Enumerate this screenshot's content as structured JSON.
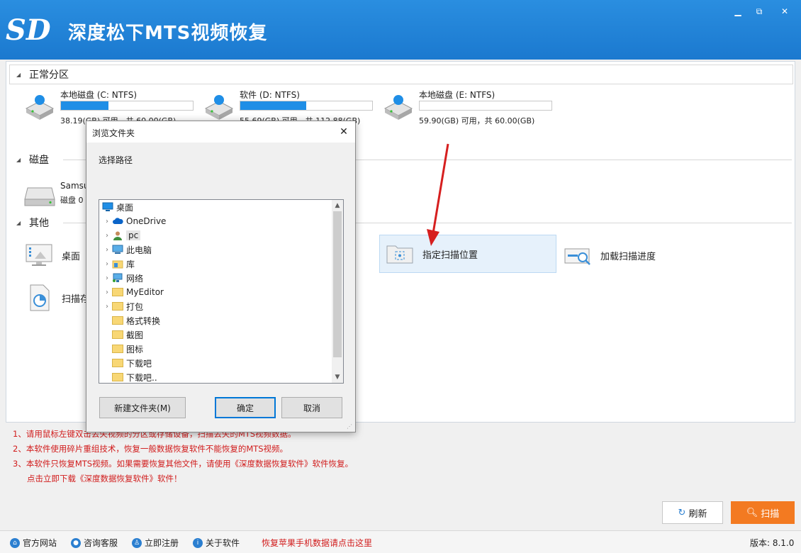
{
  "app": {
    "title": "深度松下MTS视频恢复",
    "logo_text": "SD"
  },
  "window_controls": {
    "minimize": "▁",
    "maximize": "⧉",
    "close": "✕"
  },
  "sections": {
    "normal_partition": "正常分区",
    "disk": "磁盘",
    "other": "其他"
  },
  "drives": [
    {
      "name": "本地磁盘 (C: NTFS)",
      "info": "38.19(GB) 可用，共 60.00(GB)",
      "used_fraction": 0.36
    },
    {
      "name": "软件 (D: NTFS)",
      "info": "55.69(GB) 可用，共 112.88(GB)",
      "used_fraction": 0.5
    },
    {
      "name": "本地磁盘 (E: NTFS)",
      "info": "59.90(GB) 可用，共 60.00(GB)",
      "used_fraction": 0.0
    }
  ],
  "disks": [
    {
      "name": "Samsu",
      "info": "磁盘 0"
    }
  ],
  "other_items": {
    "desktop": "桌面",
    "scan_saved": "扫描存",
    "specify_location": "指定扫描位置",
    "load_progress": "加载扫描进度"
  },
  "notes": [
    "1、请用鼠标左键双击丢失视频的分区或存储设备，扫描丢失的MTS视频数据。",
    "2、本软件使用碎片重组技术，恢复一般数据恢复软件不能恢复的MTS视频。",
    "3、本软件只恢复MTS视频。如果需要恢复其他文件，请使用《深度数据恢复软件》软件恢复。",
    "点击立即下载《深度数据恢复软件》软件！"
  ],
  "buttons": {
    "refresh": "刷新",
    "scan": "扫描"
  },
  "statusbar": {
    "website": "官方网站",
    "support": "咨询客服",
    "register": "立即注册",
    "about": "关于软件",
    "promo": "恢复苹果手机数据请点击这里",
    "version": "版本: 8.1.0"
  },
  "dialog": {
    "title": "浏览文件夹",
    "description": "选择路径",
    "tree": [
      {
        "label": "桌面",
        "icon": "desktop-icon",
        "expandable": false,
        "indent": 0
      },
      {
        "label": "OneDrive",
        "icon": "cloud-icon",
        "expandable": true,
        "indent": 1
      },
      {
        "label": "pc",
        "icon": "user-icon",
        "expandable": true,
        "indent": 1
      },
      {
        "label": "此电脑",
        "icon": "computer-icon",
        "expandable": true,
        "indent": 1
      },
      {
        "label": "库",
        "icon": "library-icon",
        "expandable": true,
        "indent": 1
      },
      {
        "label": "网络",
        "icon": "network-icon",
        "expandable": true,
        "indent": 1
      },
      {
        "label": "MyEditor",
        "icon": "folder-icon",
        "expandable": true,
        "indent": 1
      },
      {
        "label": "打包",
        "icon": "folder-icon",
        "expandable": true,
        "indent": 1
      },
      {
        "label": "格式转换",
        "icon": "folder-icon",
        "expandable": false,
        "indent": 1
      },
      {
        "label": "截图",
        "icon": "folder-icon",
        "expandable": false,
        "indent": 1
      },
      {
        "label": "图标",
        "icon": "folder-icon",
        "expandable": false,
        "indent": 1
      },
      {
        "label": "下载吧",
        "icon": "folder-icon",
        "expandable": false,
        "indent": 1
      },
      {
        "label": "下载吧..",
        "icon": "folder-icon",
        "expandable": false,
        "indent": 1
      }
    ],
    "new_folder": "新建文件夹(M)",
    "ok": "确定",
    "cancel": "取消"
  },
  "colors": {
    "titlebar": "#1f82d6",
    "accent": "#1f8ee6",
    "scan_button": "#f37a21",
    "note_text": "#d11c1c",
    "annotation_arrow": "#d61f1f"
  }
}
